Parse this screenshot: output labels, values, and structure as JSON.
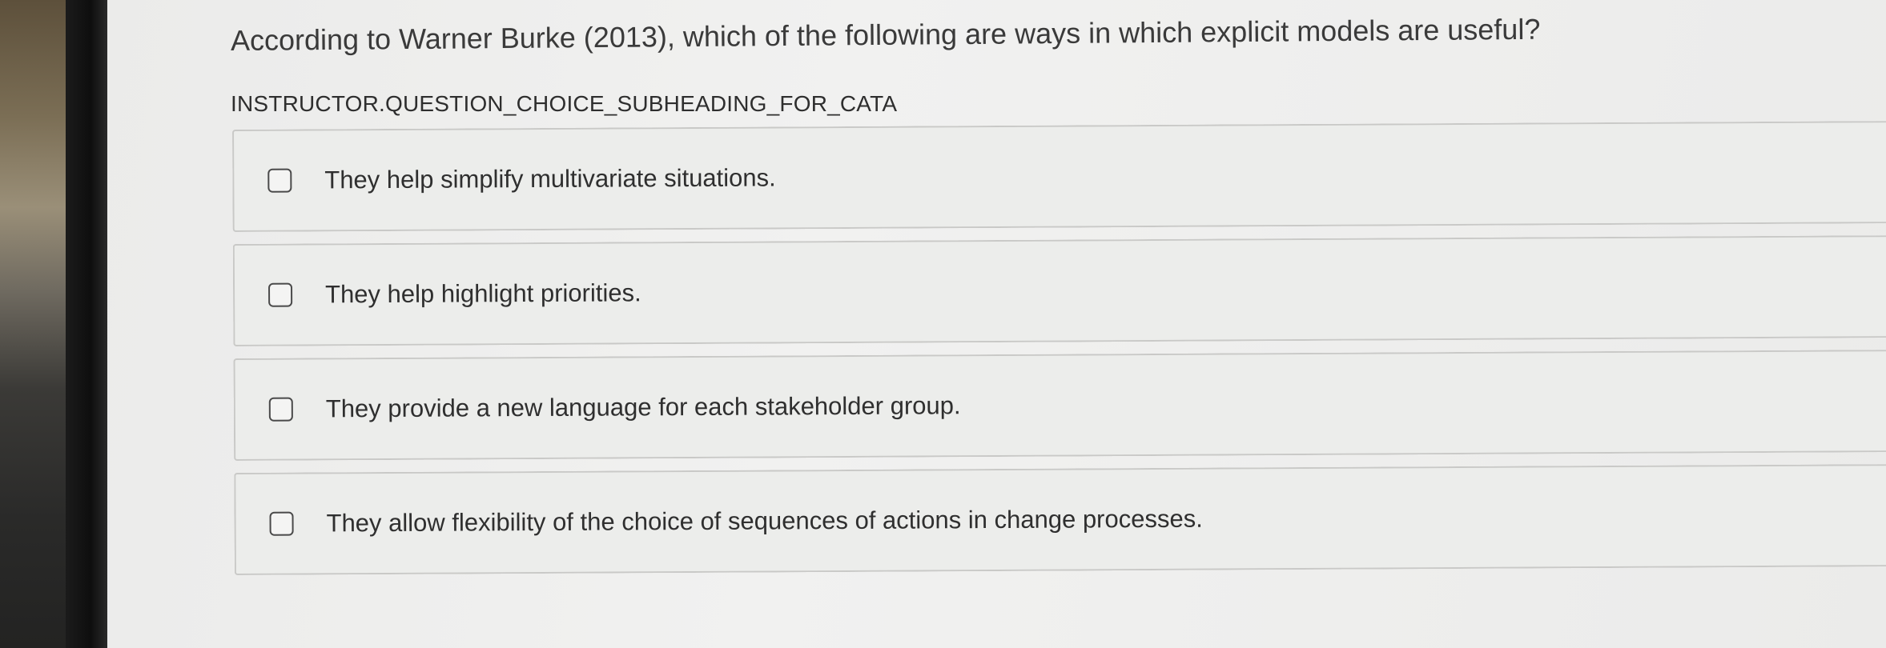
{
  "question": {
    "text": "According to Warner Burke (2013), which of the following are ways in which explicit models are useful?",
    "subheading": "INSTRUCTOR.QUESTION_CHOICE_SUBHEADING_FOR_CATA"
  },
  "choices": [
    {
      "label": "They help simplify multivariate situations.",
      "checked": false
    },
    {
      "label": "They help highlight priorities.",
      "checked": false
    },
    {
      "label": "They provide a new language for each stakeholder group.",
      "checked": false
    },
    {
      "label": "They allow flexibility of the choice of sequences of actions in change processes.",
      "checked": false
    }
  ],
  "colors": {
    "text": "#2f2f2f",
    "choice_border": "#c9c9c7",
    "choice_background": "#ecedeb",
    "checkbox_border": "#4a4a4a"
  }
}
